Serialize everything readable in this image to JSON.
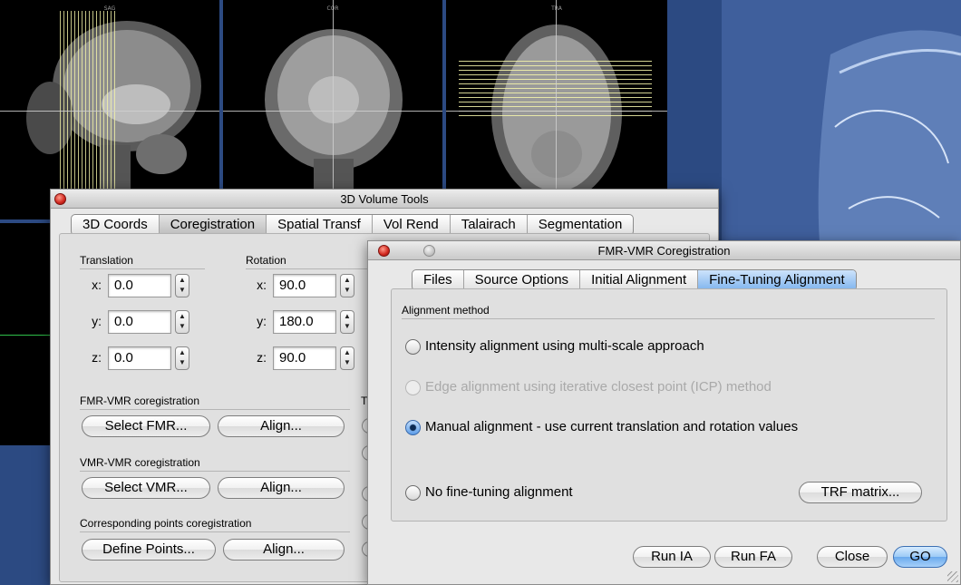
{
  "viewers": {
    "sag_label": "SAG",
    "cor_label": "COR",
    "tra_label": "TRA"
  },
  "volume_tools": {
    "title": "3D Volume Tools",
    "tabs": [
      "3D Coords",
      "Coregistration",
      "Spatial Transf",
      "Vol Rend",
      "Talairach",
      "Segmentation"
    ],
    "translation": {
      "label": "Translation",
      "x_label": "x:",
      "x": "0.0",
      "y_label": "y:",
      "y": "0.0",
      "z_label": "z:",
      "z": "0.0"
    },
    "rotation": {
      "label": "Rotation",
      "x_label": "x:",
      "x": "90.0",
      "y_label": "y:",
      "y": "180.0",
      "z_label": "z:",
      "z": "90.0"
    },
    "fmr_vmr": {
      "label": "FMR-VMR coregistration",
      "select": "Select FMR...",
      "align": "Align..."
    },
    "vmr_vmr": {
      "label": "VMR-VMR coregistration",
      "select": "Select VMR...",
      "align": "Align..."
    },
    "points": {
      "label": "Corresponding points coregistration",
      "define": "Define Points...",
      "align": "Align..."
    },
    "partial_label": "T"
  },
  "coreg_dialog": {
    "title": "FMR-VMR Coregistration",
    "tabs": [
      "Files",
      "Source Options",
      "Initial Alignment",
      "Fine-Tuning Alignment"
    ],
    "active_tab": "Fine-Tuning Alignment",
    "group_label": "Alignment method",
    "options": {
      "intensity": "Intensity alignment using multi-scale approach",
      "edge": "Edge alignment using iterative closest point (ICP) method",
      "manual": "Manual alignment - use current translation and rotation values",
      "none": "No fine-tuning alignment"
    },
    "selected_option": "manual",
    "trf_button": "TRF matrix...",
    "buttons": {
      "run_ia": "Run IA",
      "run_fa": "Run FA",
      "close": "Close",
      "go": "GO"
    }
  },
  "colors": {
    "desktop": "#2c4a82",
    "accent": "#6aaaee",
    "close_button": "#d0261d"
  }
}
